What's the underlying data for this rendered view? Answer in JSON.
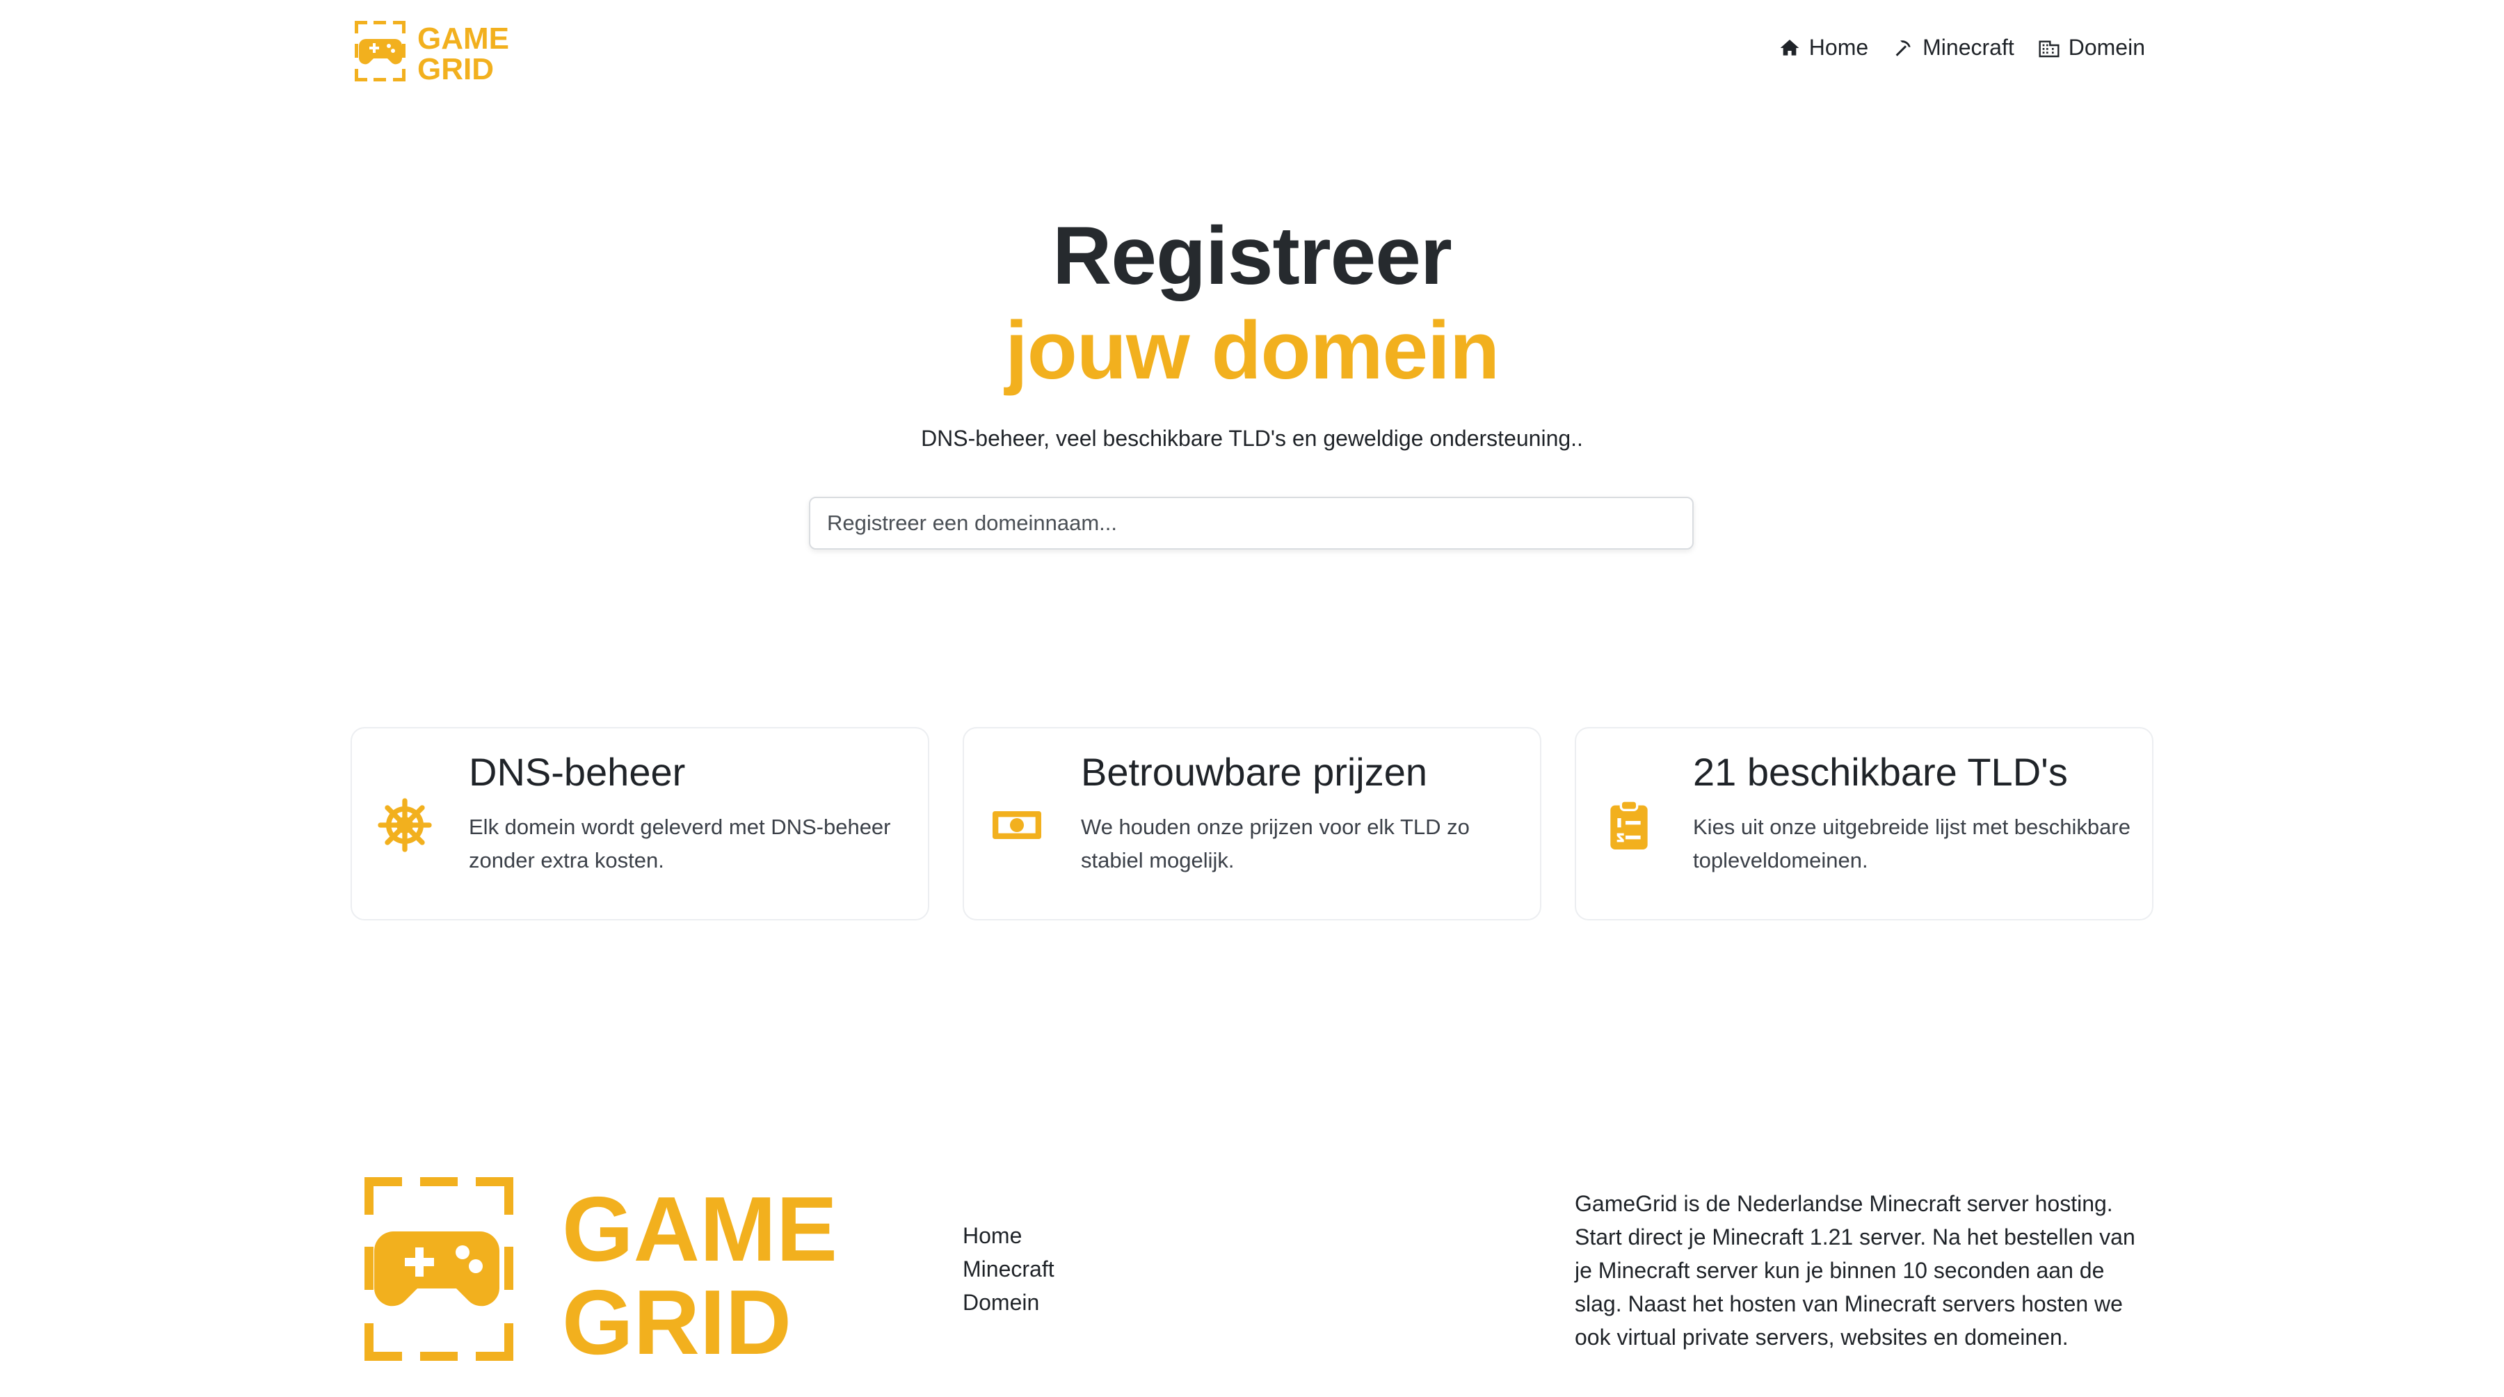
{
  "brand": {
    "name_line1": "GAME",
    "name_line2": "GRID",
    "accent_color": "#f2b01e",
    "logo_icon": "gamepad-icon"
  },
  "nav": {
    "items": [
      {
        "label": "Home",
        "icon": "home-icon"
      },
      {
        "label": "Minecraft",
        "icon": "pickaxe-icon"
      },
      {
        "label": "Domein",
        "icon": "building-icon"
      }
    ]
  },
  "hero": {
    "title": "Registreer",
    "title_accent": "jouw domein",
    "subtitle": "DNS-beheer, veel beschikbare TLD's en geweldige ondersteuning..",
    "search_placeholder": "Registreer een domeinnaam...",
    "search_value": ""
  },
  "features": [
    {
      "icon": "ship-wheel-icon",
      "title": "DNS-beheer",
      "text": "Elk domein wordt geleverd met DNS-beheer zonder extra kosten."
    },
    {
      "icon": "banknote-icon",
      "title": "Betrouwbare prijzen",
      "text": "We houden onze prijzen voor elk TLD zo stabiel mogelijk."
    },
    {
      "icon": "clipboard-list-icon",
      "title": "21 beschikbare TLD's",
      "text": "Kies uit onze uitgebreide lijst met beschikbare topleveldomeinen."
    }
  ],
  "footer": {
    "links": [
      "Home",
      "Minecraft",
      "Domein"
    ],
    "about": "GameGrid is de Nederlandse Minecraft server hosting. Start direct je Minecraft 1.21 server. Na het bestellen van je Minecraft server kun je binnen 10 seconden aan de slag. Naast het hosten van Minecraft servers hosten we ook virtual private servers, websites en domeinen."
  }
}
